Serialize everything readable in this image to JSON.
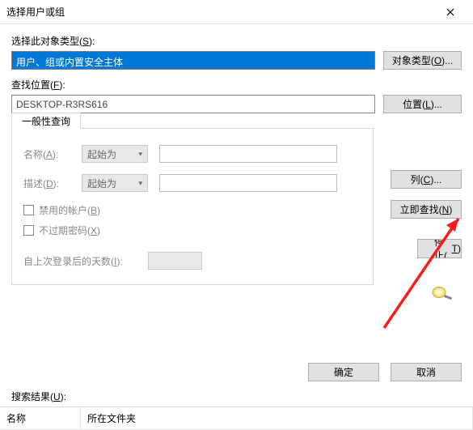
{
  "window": {
    "title": "选择用户或组"
  },
  "section1": {
    "label_pre": "选择此对象类型(",
    "label_u": "S",
    "label_post": "):",
    "value": "用户、组或内置安全主体",
    "btn_pre": "对象类型(",
    "btn_u": "O",
    "btn_post": ")..."
  },
  "section2": {
    "label_pre": "查找位置(",
    "label_u": "F",
    "label_post": "):",
    "value": "DESKTOP-R3RS616",
    "btn_pre": "位置(",
    "btn_u": "L",
    "btn_post": ")..."
  },
  "tab": {
    "label": "一般性查询"
  },
  "form": {
    "name_label_pre": "名称(",
    "name_label_u": "A",
    "name_label_post": "):",
    "desc_label_pre": "描述(",
    "desc_label_u": "D",
    "desc_label_post": "):",
    "combo1": "起始为",
    "combo2": "起始为",
    "chk1_pre": "禁用的帐户(",
    "chk1_u": "B",
    "chk1_post": ")",
    "chk2_pre": "不过期密码(",
    "chk2_u": "X",
    "chk2_post": ")",
    "days_label_pre": "自上次登录后的天数(",
    "days_label_u": "I",
    "days_label_post": "):"
  },
  "side": {
    "columns_pre": "列(",
    "columns_u": "C",
    "columns_post": ")...",
    "find_pre": "立即查找(",
    "find_u": "N",
    "find_post": ")",
    "stop_pre": "停止(",
    "stop_u": "T",
    "stop_post": ")"
  },
  "actions": {
    "ok": "确定",
    "cancel": "取消"
  },
  "results": {
    "label_pre": "搜索结果(",
    "label_u": "U",
    "label_post": "):",
    "col1": "名称",
    "col2": "所在文件夹"
  }
}
